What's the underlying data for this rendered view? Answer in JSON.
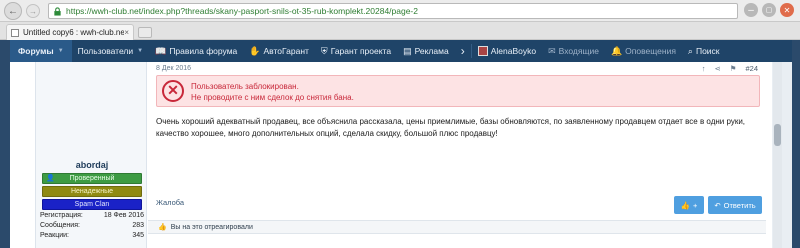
{
  "browser": {
    "url": "https://wwh-club.net/index.php?threads/skany-pasport-snils-ot-35-rub-komplekt.20284/page-2",
    "tab_title": "Untitled copy6 : wwh-club.net",
    "tab_close": "×",
    "back_glyph": "←",
    "forward_glyph": "→",
    "minimize_glyph": "–",
    "maximize_glyph": "▢",
    "close_glyph": "✕"
  },
  "nav": {
    "forums": "Форумы",
    "users": "Пользователи",
    "rules": "Правила форума",
    "autogarant": "АвтоГарант",
    "project_garant": "Гарант проекта",
    "ads": "Реклама",
    "more": "›",
    "user_name": "AlenaBoyko",
    "inbox": "Входящие",
    "alerts": "Оповещения",
    "search": "Поиск"
  },
  "user": {
    "name": "abordaj",
    "badges": [
      "Проверенный",
      "Ненадежные",
      "Spam Clan"
    ],
    "stats": [
      {
        "label": "Регистрация:",
        "value": "18 Фев 2016"
      },
      {
        "label": "Сообщения:",
        "value": "283"
      },
      {
        "label": "Реакции:",
        "value": "345"
      }
    ]
  },
  "post": {
    "date": "8 Дек 2016",
    "number": "#24",
    "warning_line1": "Пользователь заблокирован.",
    "warning_line2": "Не проводите с ним сделок до снятия бана.",
    "text": "Очень хороший адекватный продавец, все объяснила рассказала, цены приемлимые, базы обновляются, по заявленному продавцем отдает все в одни руки, качество хорошее, много дополнительных опций, сделала скидку, большой плюс продавцу!",
    "report": "Жалоба",
    "like_label": "+",
    "reply_label": "Ответить",
    "reactions_note": "Вы на это отреагировали"
  },
  "colors": {
    "nav_bg": "#1f4468",
    "warn_text": "#c8283a",
    "button": "#4f9fe0",
    "badge_verified": "#3d9b43",
    "badge_unreliable": "#8f8a12",
    "badge_spam": "#1a22c7"
  }
}
